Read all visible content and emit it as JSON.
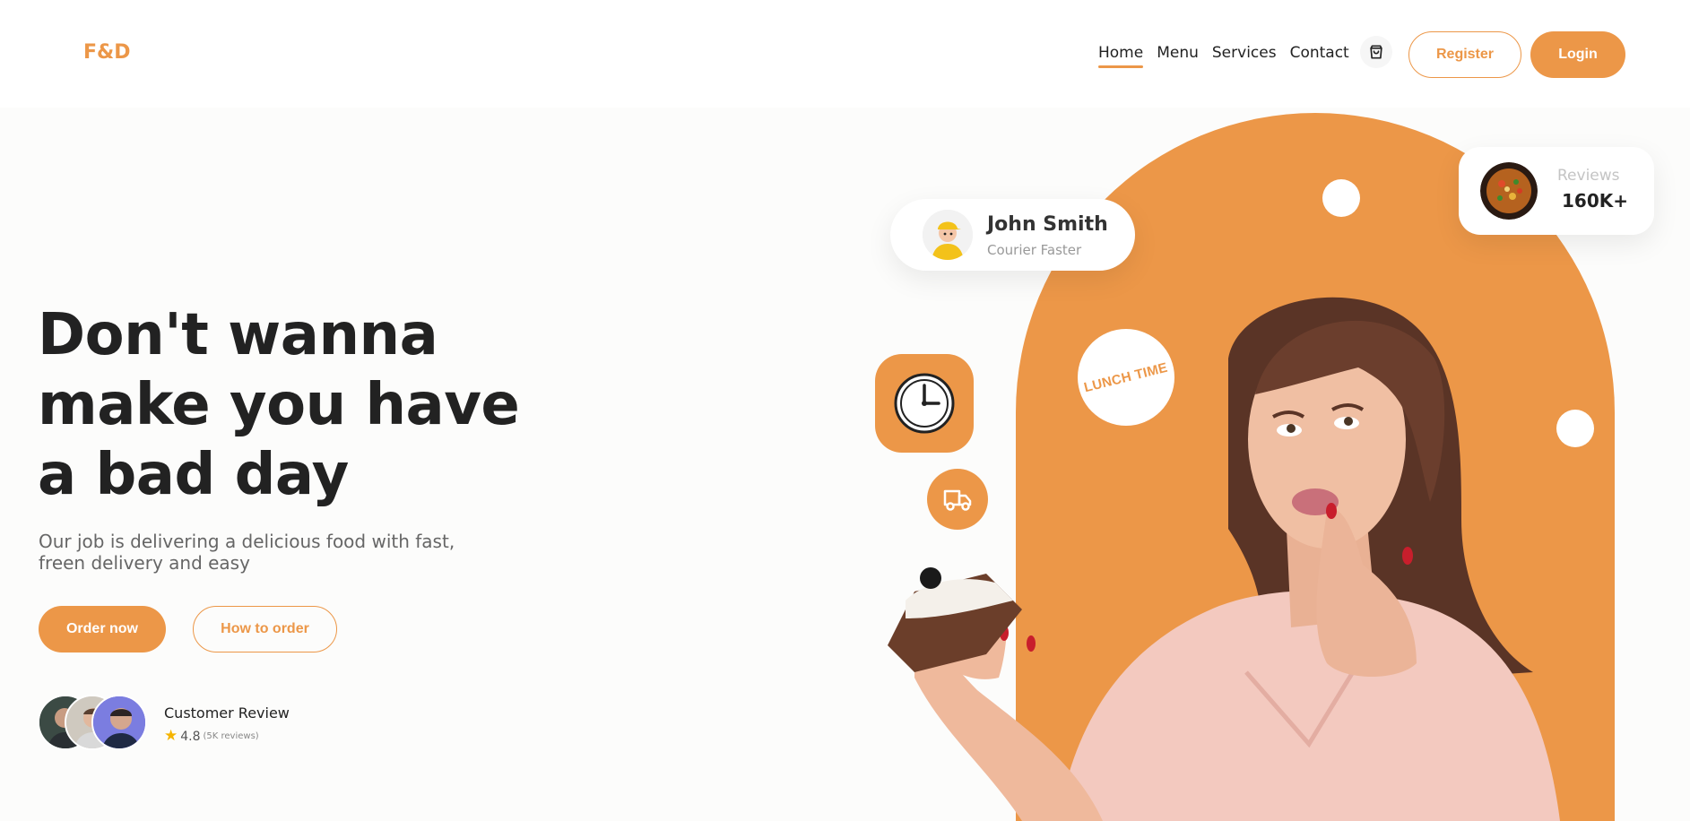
{
  "brand": {
    "logo": "F&D",
    "accent_color": "#ec9748"
  },
  "nav": {
    "items": [
      {
        "label": "Home",
        "active": true
      },
      {
        "label": "Menu",
        "active": false
      },
      {
        "label": "Services",
        "active": false
      },
      {
        "label": "Contact",
        "active": false
      }
    ],
    "cart_icon": "shopping-bag-icon",
    "register_label": "Register",
    "login_label": "Login"
  },
  "hero": {
    "headline_lines": [
      "Don't wanna",
      "make you have",
      "a bad day"
    ],
    "subtext_lines": [
      "Our job is delivering a delicious food with fast,",
      "freen delivery and easy"
    ],
    "primary_button": "Order now",
    "secondary_button": "How to order"
  },
  "customer_review": {
    "title": "Customer Review",
    "rating": "4.8",
    "count": "(5K reviews)",
    "star_icon": "star-icon"
  },
  "courier_card": {
    "name": "John Smith",
    "role": "Courier Faster"
  },
  "reviews_card": {
    "label": "Reviews",
    "value": "160K+"
  },
  "badges": {
    "lunch_time": "LUNCH TIME",
    "clock_icon": "clock-icon",
    "truck_icon": "delivery-truck-icon"
  }
}
